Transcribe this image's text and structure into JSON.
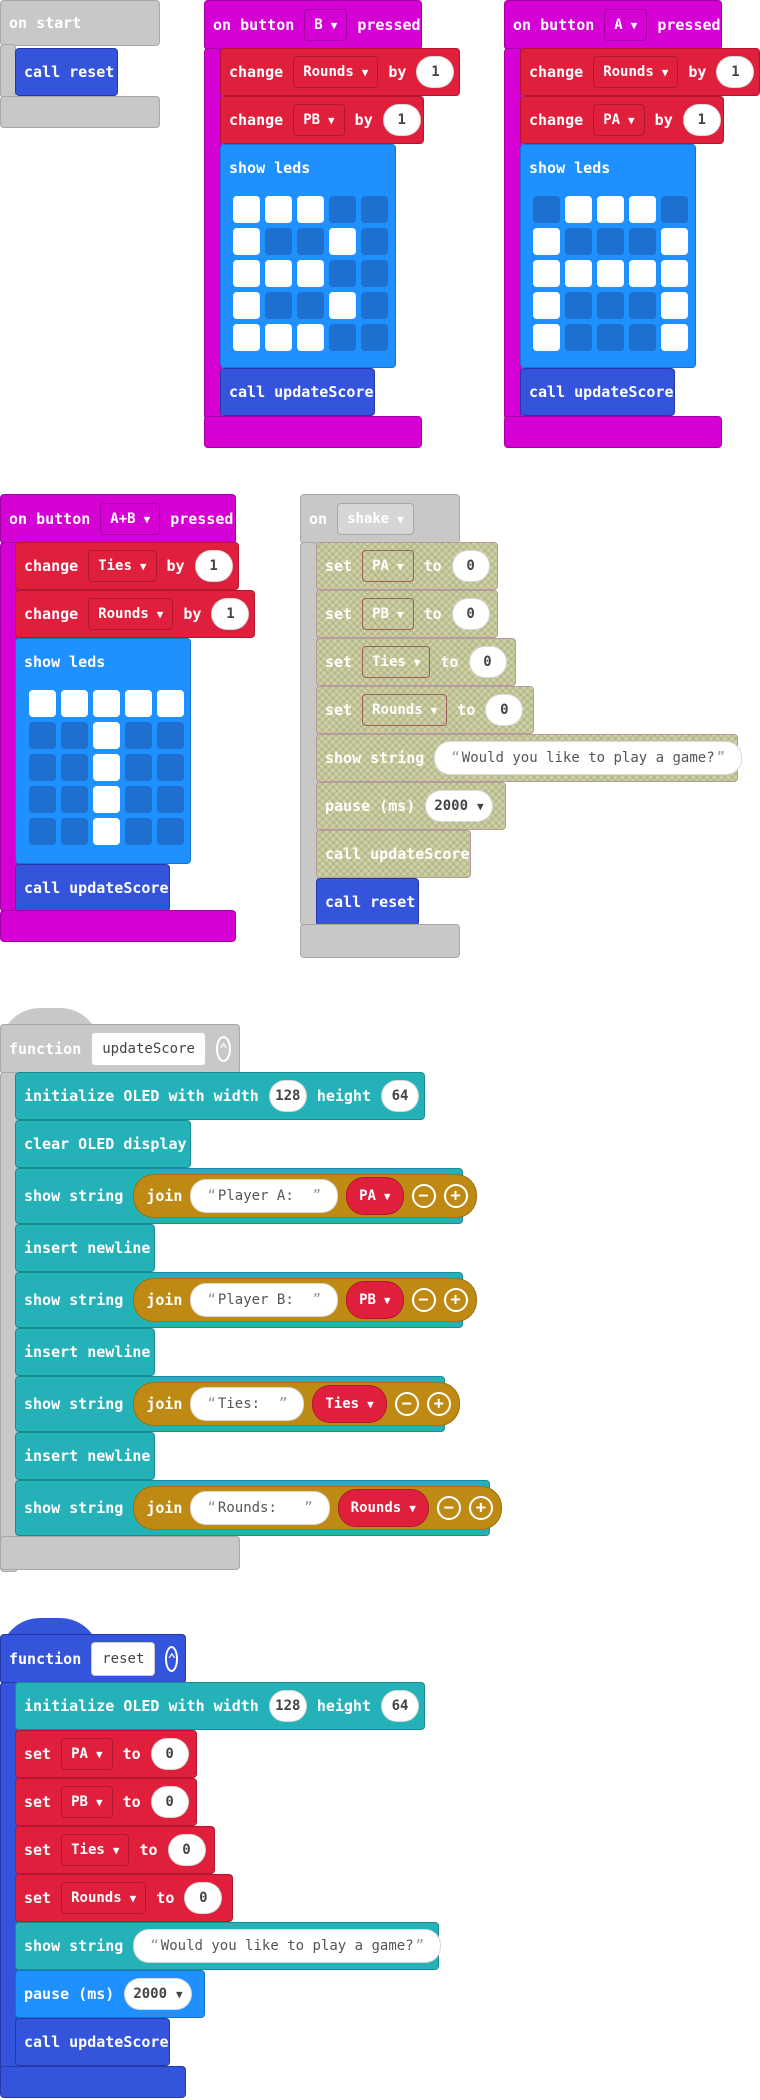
{
  "on_start": {
    "label": "on start",
    "call": "call reset"
  },
  "button_b": {
    "label_pre": "on button",
    "button": "B",
    "label_post": "pressed",
    "change1": {
      "label": "change",
      "var": "Rounds",
      "by": "by",
      "value": "1"
    },
    "change2": {
      "label": "change",
      "var": "PB",
      "by": "by",
      "value": "1"
    },
    "show_leds": "show leds",
    "leds": [
      1,
      1,
      1,
      0,
      0,
      1,
      0,
      0,
      1,
      0,
      1,
      1,
      1,
      0,
      0,
      1,
      0,
      0,
      1,
      0,
      1,
      1,
      1,
      0,
      0
    ],
    "call": "call updateScore"
  },
  "button_a": {
    "label_pre": "on button",
    "button": "A",
    "label_post": "pressed",
    "change1": {
      "label": "change",
      "var": "Rounds",
      "by": "by",
      "value": "1"
    },
    "change2": {
      "label": "change",
      "var": "PA",
      "by": "by",
      "value": "1"
    },
    "show_leds": "show leds",
    "leds": [
      0,
      1,
      1,
      1,
      0,
      1,
      0,
      0,
      0,
      1,
      1,
      1,
      1,
      1,
      1,
      1,
      0,
      0,
      0,
      1,
      1,
      0,
      0,
      0,
      1
    ],
    "call": "call updateScore"
  },
  "button_ab": {
    "label_pre": "on button",
    "button": "A+B",
    "label_post": "pressed",
    "change1": {
      "label": "change",
      "var": "Ties",
      "by": "by",
      "value": "1"
    },
    "change2": {
      "label": "change",
      "var": "Rounds",
      "by": "by",
      "value": "1"
    },
    "show_leds": "show leds",
    "leds": [
      1,
      1,
      1,
      1,
      1,
      0,
      0,
      1,
      0,
      0,
      0,
      0,
      1,
      0,
      0,
      0,
      0,
      1,
      0,
      0,
      0,
      0,
      1,
      0,
      0
    ],
    "call": "call updateScore"
  },
  "on_shake": {
    "label": "on",
    "event": "shake",
    "set1": {
      "label": "set",
      "var": "PA",
      "to": "to",
      "value": "0"
    },
    "set2": {
      "label": "set",
      "var": "PB",
      "to": "to",
      "value": "0"
    },
    "set3": {
      "label": "set",
      "var": "Ties",
      "to": "to",
      "value": "0"
    },
    "set4": {
      "label": "set",
      "var": "Rounds",
      "to": "to",
      "value": "0"
    },
    "show_string": {
      "label": "show string",
      "value": "Would you like to play a game?"
    },
    "pause": {
      "label": "pause (ms)",
      "value": "2000"
    },
    "call1": "call updateScore",
    "call2": "call reset"
  },
  "fn_update": {
    "label": "function",
    "name": "updateScore",
    "init": {
      "label": "initialize OLED with width",
      "width": "128",
      "height_label": "height",
      "height": "64"
    },
    "clear": "clear OLED display",
    "rows": [
      {
        "label": "show string",
        "join": "join",
        "text": "Player A:  ",
        "var": "PA"
      },
      {
        "label": "show string",
        "join": "join",
        "text": "Player B:  ",
        "var": "PB"
      },
      {
        "label": "show string",
        "join": "join",
        "text": "Ties:  ",
        "var": "Ties"
      },
      {
        "label": "show string",
        "join": "join",
        "text": "Rounds:   ",
        "var": "Rounds"
      }
    ],
    "newline": "insert newline"
  },
  "fn_reset": {
    "label": "function",
    "name": "reset",
    "init": {
      "label": "initialize OLED with width",
      "width": "128",
      "height_label": "height",
      "height": "64"
    },
    "set1": {
      "label": "set",
      "var": "PA",
      "to": "to",
      "value": "0"
    },
    "set2": {
      "label": "set",
      "var": "PB",
      "to": "to",
      "value": "0"
    },
    "set3": {
      "label": "set",
      "var": "Ties",
      "to": "to",
      "value": "0"
    },
    "set4": {
      "label": "set",
      "var": "Rounds",
      "to": "to",
      "value": "0"
    },
    "show_string": {
      "label": "show string",
      "value": "Would you like to play a game?"
    },
    "pause": {
      "label": "pause (ms)",
      "value": "2000"
    },
    "call": "call updateScore"
  },
  "icons": {
    "dropdown": "caret-down-icon",
    "collapse": "chevron-up-icon",
    "add": "plus-icon",
    "remove": "minus-icon"
  }
}
